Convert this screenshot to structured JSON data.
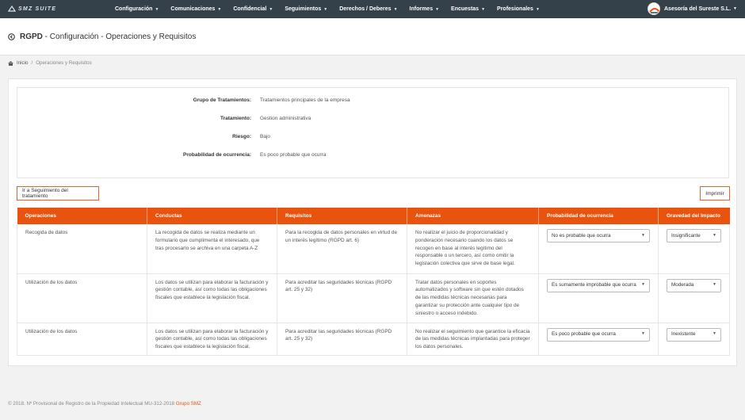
{
  "navbar": {
    "brand": "SMZ SUITE",
    "menu": [
      {
        "label": "Configuración"
      },
      {
        "label": "Comunicaciones"
      },
      {
        "label": "Confidencial"
      },
      {
        "label": "Seguimientos"
      },
      {
        "label": "Derechos / Deberes"
      },
      {
        "label": "Informes"
      },
      {
        "label": "Encuestas"
      },
      {
        "label": "Profesionales"
      }
    ],
    "user": "Asesoría del Sureste S.L."
  },
  "header": {
    "title_bold": "RGPD",
    "title_rest": " - Configuración - Operaciones y Requisitos"
  },
  "breadcrumb": {
    "home": "Inicio",
    "separator": "/",
    "current": "Operaciones y Requisitos"
  },
  "info": {
    "group_label": "Grupo de Tratamientos:",
    "group_value": "Tratamientos principales de la empresa",
    "treatment_label": "Tratamiento:",
    "treatment_value": "Gestion administrativa",
    "risk_label": "Riesgo:",
    "risk_value": "Bajo",
    "probability_label": "Probabilidad de ocurrencia:",
    "probability_value": "Es poco probable que ocurra"
  },
  "actions": {
    "follow_up": "Ir a Seguimiento del tratamiento",
    "print": "Imprimir"
  },
  "table": {
    "headers": [
      "Operaciones",
      "Conductas",
      "Requisitos",
      "Amenazas",
      "Probabilidad de ocurrencia",
      "Gravedad del Impacto"
    ],
    "rows": [
      {
        "operation": "Recogida de datos",
        "conduct": "La recogida de datos se realiza mediante un formulario que cumplimenta el interesado, que tras procesarlo se archiva en una carpeta A-Z",
        "requirement": "Para la recogida de datos personales en virtud de un interés legítimo (RGPD art. 6)",
        "threat": "No realizar el juicio de proporcionalidad y ponderación necesario cuando los datos se recogen en base al interés legítimo del responsable o un tercero, así como omitir la legislación colectiva que sirve de base legal.",
        "probability": "No es probable que ocurra",
        "severity": "Insignificante"
      },
      {
        "operation": "Utilización de los datos",
        "conduct": "Los datos se utilizan para elaborar la facturación y gestión contable, así como todas las obligaciones fiscales que establece la legislación fiscal.",
        "requirement": "Para acreditar las seguridades técnicas (RGPD art. 25 y 32)",
        "threat": "Tratar datos personales en soportes automatizados y software sin que estén dotados de las medidas técnicas necesarias para garantizar su protección ante cualquier tipo de siniestro o acceso indebido.",
        "probability": "Es sumamente improbable que ocurra",
        "severity": "Moderada"
      },
      {
        "operation": "Utilización de los datos",
        "conduct": "Los datos se utilizan para elaborar la facturación y gestión contable, así como todas las obligaciones fiscales que establece la legislación fiscal.",
        "requirement": "Para acreditar las seguridades técnicas (RGPD art. 25 y 32)",
        "threat": "No realizar el seguimiento que garantice la eficacia de las medidas técnicas implantadas para proteger los datos personales.",
        "probability": "Es poco probable que ocurra",
        "severity": "Inexistente"
      }
    ]
  },
  "footer": {
    "text": "© 2018. Nº Provisional de Registro de la Propiedad Intelectual MU-312-2018 ",
    "link": "Grupo SMZ"
  },
  "colors": {
    "navbar": "#34404a",
    "accent": "#e8530e"
  }
}
